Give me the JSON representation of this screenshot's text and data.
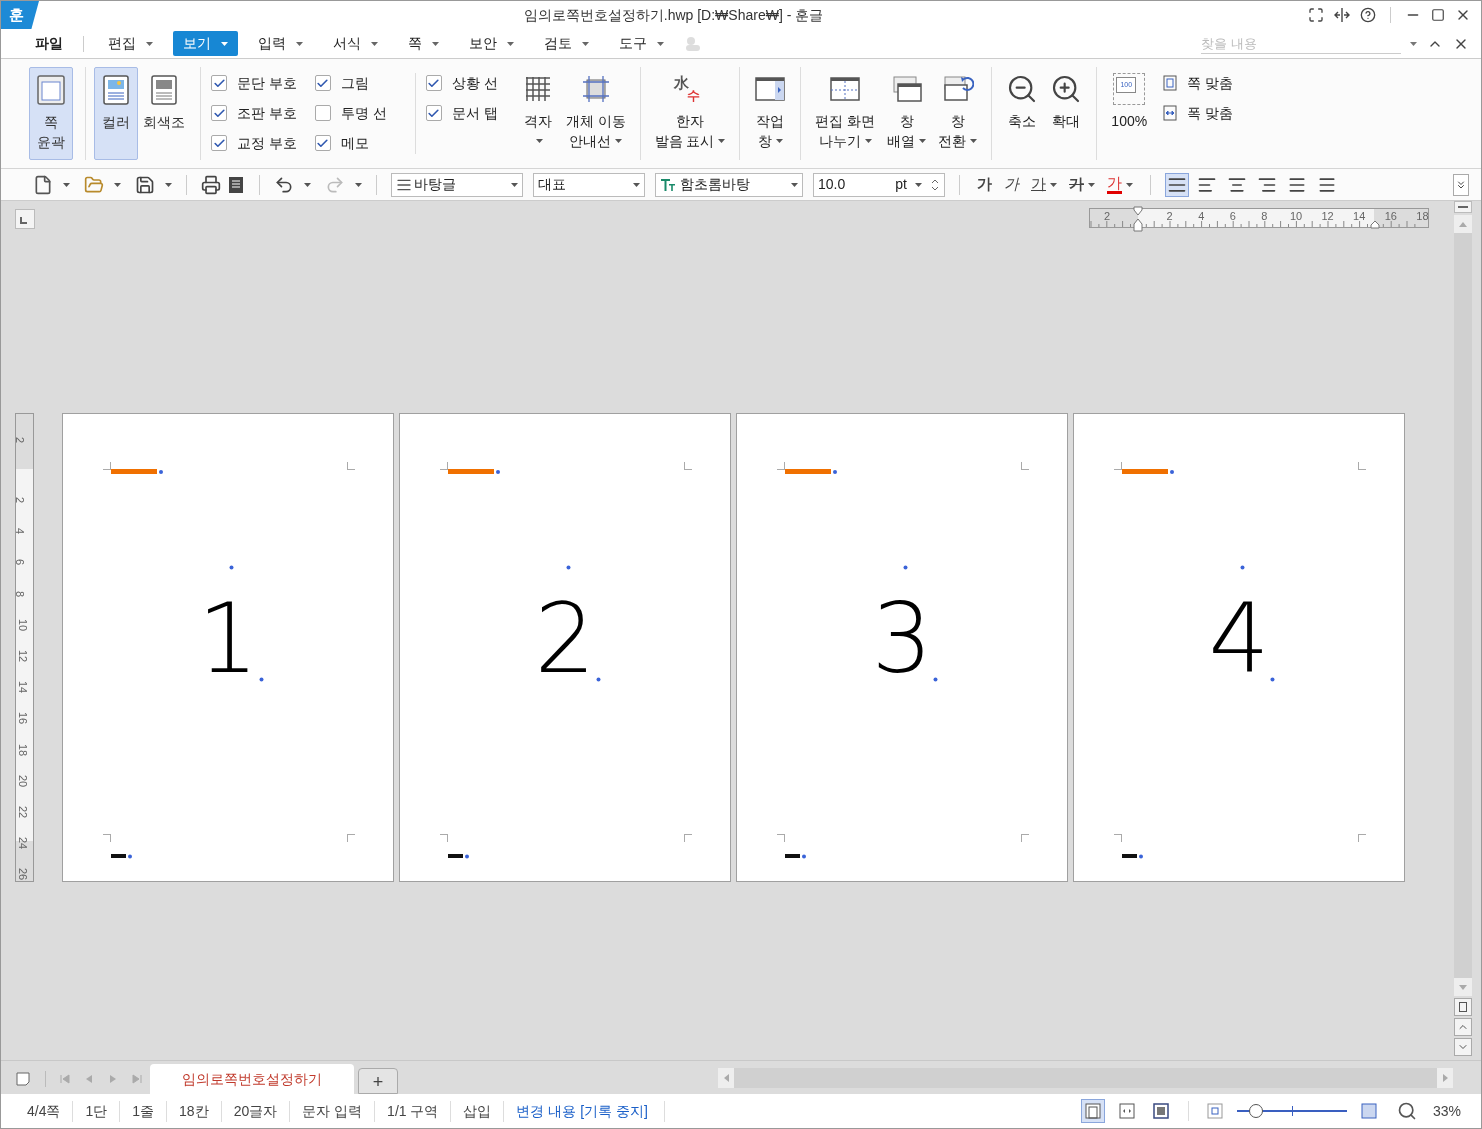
{
  "window": {
    "logo": "훈",
    "title": "임의로쪽번호설정하기.hwp [D:₩Share₩] - 훈글"
  },
  "menu": [
    {
      "label": "파일",
      "selected": false,
      "dropdown": false
    },
    {
      "label": "편집",
      "selected": false,
      "dropdown": true
    },
    {
      "label": "보기",
      "selected": true,
      "dropdown": true
    },
    {
      "label": "입력",
      "selected": false,
      "dropdown": true
    },
    {
      "label": "서식",
      "selected": false,
      "dropdown": true
    },
    {
      "label": "쪽",
      "selected": false,
      "dropdown": true
    },
    {
      "label": "보안",
      "selected": false,
      "dropdown": true
    },
    {
      "label": "검토",
      "selected": false,
      "dropdown": true
    },
    {
      "label": "도구",
      "selected": false,
      "dropdown": true
    }
  ],
  "search": {
    "placeholder": "찾을 내용"
  },
  "ribbon": {
    "view_buttons": [
      {
        "lines": [
          "쪽",
          "윤곽"
        ],
        "kind": "outline",
        "selected": true
      },
      {
        "lines": [
          "컬러"
        ],
        "kind": "color",
        "selected": true
      },
      {
        "lines": [
          "회색조"
        ],
        "kind": "gray",
        "selected": false
      }
    ],
    "check_columns": [
      [
        {
          "label": "문단 부호",
          "checked": true
        },
        {
          "label": "조판 부호",
          "checked": true
        },
        {
          "label": "교정 부호",
          "checked": true
        }
      ],
      [
        {
          "label": "그림",
          "checked": true
        },
        {
          "label": "투명 선",
          "checked": false
        },
        {
          "label": "메모",
          "checked": true
        }
      ],
      [
        {
          "label": "상황 선",
          "checked": true
        },
        {
          "label": "문서 탭",
          "checked": true
        }
      ]
    ],
    "button_groups": [
      [
        {
          "kind": "grid",
          "lines": [
            "격자"
          ],
          "dropdown": true
        },
        {
          "kind": "guides",
          "lines": [
            "개체 이동",
            "안내선"
          ],
          "dropdown": true
        }
      ],
      [
        {
          "kind": "hanja",
          "glyphs": [
            "水",
            "수"
          ],
          "lines": [
            "한자",
            "발음 표시"
          ],
          "dropdown": true
        }
      ],
      [
        {
          "kind": "task",
          "lines": [
            "작업",
            "창"
          ],
          "dropdown": true
        }
      ],
      [
        {
          "kind": "split",
          "lines": [
            "편집 화면",
            "나누기"
          ],
          "dropdown": true
        },
        {
          "kind": "arrange",
          "lines": [
            "창",
            "배열"
          ],
          "dropdown": true
        },
        {
          "kind": "switch",
          "lines": [
            "창",
            "전환"
          ],
          "dropdown": true
        }
      ],
      [
        {
          "kind": "zoom_out",
          "lines": [
            "축소"
          ],
          "dropdown": false
        },
        {
          "kind": "zoom_in",
          "lines": [
            "확대"
          ],
          "dropdown": false
        }
      ],
      [
        {
          "kind": "zoom_100",
          "glyphs": [
            "100"
          ],
          "lines": [
            "100%"
          ],
          "dropdown": false
        }
      ]
    ],
    "fit": [
      {
        "kind": "page",
        "label": "쪽 맞춤"
      },
      {
        "kind": "width",
        "label": "폭 맞춤"
      }
    ]
  },
  "toolbar": {
    "style": "바탕글",
    "language": "대표",
    "font": "함초롬바탕",
    "size": "10.0",
    "unit": "pt",
    "char_buttons": [
      {
        "text": "가",
        "kind": "bold",
        "dropdown": false
      },
      {
        "text": "가",
        "kind": "italic",
        "dropdown": false
      },
      {
        "text": "가",
        "kind": "underline",
        "dropdown": true
      },
      {
        "text": "가",
        "kind": "strike",
        "dropdown": true
      },
      {
        "text": "가",
        "kind": "color",
        "dropdown": true
      }
    ],
    "align": [
      {
        "kind": "justify",
        "selected": true
      },
      {
        "kind": "left",
        "selected": false
      },
      {
        "kind": "center",
        "selected": false
      },
      {
        "kind": "right",
        "selected": false
      },
      {
        "kind": "distribute",
        "selected": false
      },
      {
        "kind": "divide",
        "selected": false
      }
    ]
  },
  "rulers": {
    "horizontal": [
      "2",
      "2",
      "4",
      "6",
      "8",
      "10",
      "12",
      "14",
      "16",
      "18"
    ],
    "vertical": [
      "2",
      "2",
      "4",
      "6",
      "8",
      "10",
      "12",
      "14",
      "16",
      "18",
      "20",
      "22",
      "24",
      "26"
    ]
  },
  "pages": [
    {
      "number": "1"
    },
    {
      "number": "2"
    },
    {
      "number": "3"
    },
    {
      "number": "4"
    }
  ],
  "doc_tabs": [
    {
      "label": "임의로쪽번호설정하기",
      "selected": true
    }
  ],
  "add_tab": "+",
  "status": [
    {
      "text": "4/4쪽",
      "kind": "plain"
    },
    {
      "text": "1단",
      "kind": "plain"
    },
    {
      "text": "1줄",
      "kind": "plain"
    },
    {
      "text": "18칸",
      "kind": "plain"
    },
    {
      "text": "20글자",
      "kind": "plain"
    },
    {
      "text": "문자 입력",
      "kind": "plain"
    },
    {
      "text": "1/1 구역",
      "kind": "plain"
    },
    {
      "text": "삽입",
      "kind": "plain"
    },
    {
      "text": "변경 내용 [기록 중지]",
      "kind": "link"
    }
  ],
  "view_modes": [
    {
      "kind": "page",
      "selected": true
    },
    {
      "kind": "width",
      "selected": false
    },
    {
      "kind": "full",
      "selected": false
    }
  ],
  "zoom": {
    "level": 0.17,
    "reading": "33%"
  }
}
